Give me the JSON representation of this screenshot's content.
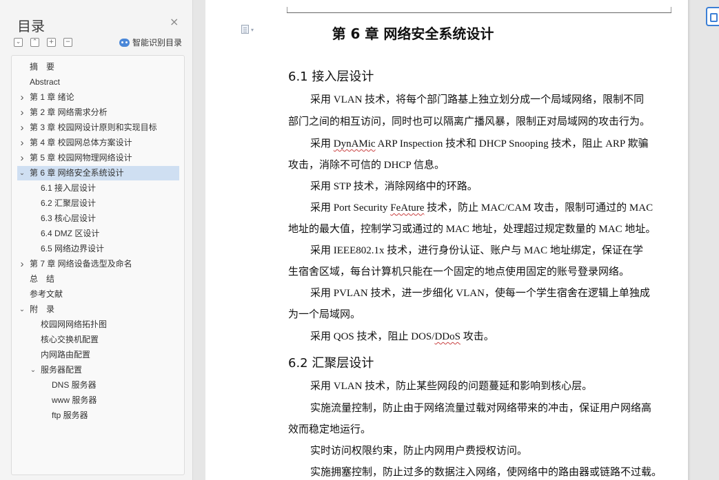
{
  "nav": {
    "title": "目录",
    "close_icon": "×",
    "smart_toc_label": "智能识别目录",
    "toolbar": [
      {
        "name": "collapse-all-button",
        "glyph": "⌄"
      },
      {
        "name": "expand-up-button",
        "glyph": "⌃"
      },
      {
        "name": "add-heading-button",
        "glyph": "+"
      },
      {
        "name": "remove-heading-button",
        "glyph": "−"
      }
    ],
    "toc": [
      {
        "label": "摘　要",
        "level": 0,
        "arrow": ""
      },
      {
        "label": "Abstract",
        "level": 0,
        "arrow": ""
      },
      {
        "label": "第 1 章  绪论",
        "level": 0,
        "arrow": "›"
      },
      {
        "label": "第 2 章  网络需求分析",
        "level": 0,
        "arrow": "›"
      },
      {
        "label": "第 3 章  校园网设计原则和实现目标",
        "level": 0,
        "arrow": "›"
      },
      {
        "label": "第 4 章  校园网总体方案设计",
        "level": 0,
        "arrow": "›"
      },
      {
        "label": "第 5 章  校园网物理网络设计",
        "level": 0,
        "arrow": "›"
      },
      {
        "label": "第 6 章  网络安全系统设计",
        "level": 0,
        "arrow": "⌄",
        "active": true
      },
      {
        "label": "6.1 接入层设计",
        "level": 1,
        "arrow": ""
      },
      {
        "label": "6.2 汇聚层设计",
        "level": 1,
        "arrow": ""
      },
      {
        "label": "6.3 核心层设计",
        "level": 1,
        "arrow": ""
      },
      {
        "label": "6.4 DMZ 区设计",
        "level": 1,
        "arrow": ""
      },
      {
        "label": "6.5 网络边界设计",
        "level": 1,
        "arrow": ""
      },
      {
        "label": "第 7 章  网络设备选型及命名",
        "level": 0,
        "arrow": "›"
      },
      {
        "label": "总　结",
        "level": 0,
        "arrow": ""
      },
      {
        "label": "参考文献",
        "level": 0,
        "arrow": ""
      },
      {
        "label": "附　录",
        "level": 0,
        "arrow": "⌄"
      },
      {
        "label": "校园网网络拓扑图",
        "level": 1,
        "arrow": ""
      },
      {
        "label": "核心交换机配置",
        "level": 1,
        "arrow": ""
      },
      {
        "label": "内网路由配置",
        "level": 1,
        "arrow": ""
      },
      {
        "label": "服务器配置",
        "level": 1,
        "arrow": "⌄"
      },
      {
        "label": "DNS 服务器",
        "level": 2,
        "arrow": ""
      },
      {
        "label": "www 服务器",
        "level": 2,
        "arrow": ""
      },
      {
        "label": "ftp 服务器",
        "level": 2,
        "arrow": ""
      }
    ]
  },
  "doc": {
    "chapter_title": "第 6 章  网络安全系统设计",
    "section_1": "6.1 接入层设计",
    "section_2": "6.2 汇聚层设计",
    "lines": [
      [
        "采用 VLAN 技术，将每个部门路基上独立划分成一个局域网络，限制不同"
      ],
      [
        "部门之间的相互访问，同时也可以隔离广播风暴，限制正对局域网的攻击行为。"
      ],
      [
        "采用 ",
        "DynAMic",
        " ARP Inspection 技术和 DHCP Snooping 技术，阻止 ARP 欺骗"
      ],
      [
        "攻击，消除不可信的 DHCP  信息。"
      ],
      [
        "采用 STP 技术，消除网络中的环路。"
      ],
      [
        "采用 Port Security ",
        "FeAture",
        " 技术，防止 MAC/CAM 攻击，限制可通过的 MAC"
      ],
      [
        "地址的最大值，控制学习或通过的 MAC 地址，处理超过规定数量的 MAC 地址。"
      ],
      [
        "采用 IEEE802.1x 技术，进行身份认证、账户与 MAC 地址绑定，保证在学"
      ],
      [
        "生宿舍区域，每台计算机只能在一个固定的地点使用固定的账号登录网络。"
      ],
      [
        "采用 PVLAN 技术，进一步细化 VLAN，使每一个学生宿舍在逻辑上单独成"
      ],
      [
        "为一个局域网。"
      ],
      [
        "采用 QOS 技术，阻止 DOS/",
        "DDoS",
        " 攻击。"
      ],
      [
        "采用 VLAN 技术，防止某些网段的问题蔓延和影响到核心层。"
      ],
      [
        "实施流量控制，防止由于网络流量过载对网络带来的冲击，保证用户网络高"
      ],
      [
        "效而稳定地运行。"
      ],
      [
        "实时访问权限约束，防止内网用户费授权访问。"
      ],
      [
        "实施拥塞控制，防止过多的数据注入网络，使网络中的路由器或链路不过载。"
      ]
    ]
  }
}
